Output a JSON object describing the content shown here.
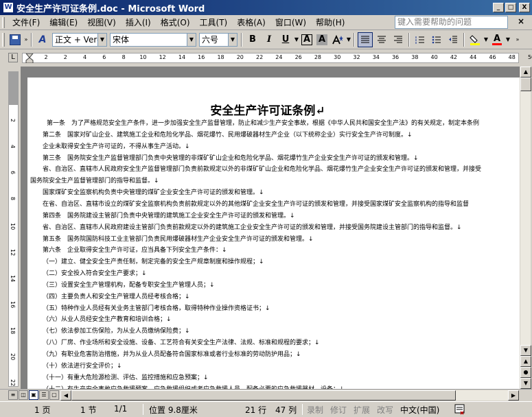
{
  "window": {
    "title": "安全生产许可证条例.doc - Microsoft Word",
    "icon_text": "W",
    "minimize_label": "_",
    "maximize_label": "□",
    "close_label": "X"
  },
  "menu": {
    "items": [
      "文件(F)",
      "编辑(E)",
      "视图(V)",
      "插入(I)",
      "格式(O)",
      "工具(T)",
      "表格(A)",
      "窗口(W)",
      "帮助(H)"
    ],
    "help_placeholder": "键入需要帮助的问题",
    "close_label": "×"
  },
  "toolbar": {
    "style_value": "正文 + Verd",
    "font_value": "宋体",
    "size_value": "六号",
    "bold": "B",
    "italic": "I",
    "underline": "U",
    "char_border": "A",
    "char_shading": "A",
    "font_color": "A",
    "dropdown_arrow": "▼",
    "chevron": "»"
  },
  "ruler": {
    "numbers": [
      "2",
      "2",
      "4",
      "6",
      "8",
      "10",
      "12",
      "14",
      "16",
      "18",
      "20",
      "22",
      "24",
      "26",
      "28",
      "30",
      "32",
      "34",
      "36",
      "38",
      "40",
      "42",
      "44",
      "46",
      "48",
      "50"
    ],
    "corner_label": "L"
  },
  "vruler": {
    "numbers": [
      "2",
      "4",
      "6",
      "8",
      "10",
      "12",
      "14",
      "16",
      "18",
      "20",
      "22"
    ]
  },
  "document": {
    "title": "安全生产许可证条例↵",
    "lines": [
      "第一条　为了严格规范安全生产条件，进一步加强安全生产监督管理，防止和减少生产安全事故，根据《中华人民共和国安全生产法》的有关规定，制定本条例",
      "第二条　国家对矿山企业、建筑施工企业和危险化学品、烟花爆竹、民用爆破器材生产企业（以下统称企业）实行安全生产许可制度。↓",
      "企业未取得安全生产许可证的，不得从事生产活动。↓",
      "第三条　国务院安全生产监督管理部门负责中央管理的非煤矿矿山企业和危险化学品、烟花爆竹生产企业安全生产许可证的颁发和管理。↓",
      "省、自治区、直辖市人民政府安全生产监督管理部门负责前款规定以外的非煤矿矿山企业和危险化学品、烟花爆竹生产企业安全生产许可证的颁发和管理，并接受",
      "国务院安全生产监督管理部门的指导和监督。↓",
      "国家煤矿安全监察机构负责中央管理的煤矿企业安全生产许可证的颁发和管理。↓",
      "在省、自治区、直辖市设立的煤矿安全监察机构负责前款规定以外的其他煤矿企业安全生产许可证的颁发和管理，并接受国家煤矿安全监察机构的指导和监督",
      "第四条　国务院建设主管部门负责中央管理的建筑施工企业安全生产许可证的颁发和管理。↓",
      "省、自治区、直辖市人民政府建设主管部门负责前款规定以外的建筑施工企业安全生产许可证的颁发和管理，并接受国务院建设主管部门的指导和监督。↓",
      "第五条　国务院国防科技工业主管部门负责民用爆破器材生产企业安全生产许可证的颁发和管理。↓",
      "第六条　企业取得安全生产许可证，应当具备下列安全生产条件：↓",
      "（一）建立、健全安全生产责任制，制定完备的安全生产规章制度和操作规程；↓",
      "（二）安全投入符合安全生产要求；↓",
      "（三）设置安全生产管理机构，配备专职安全生产管理人员；↓",
      "（四）主要负责人和安全生产管理人员经考核合格；↓",
      "（五）特种作业人员经有关业务主管部门考核合格，取得特种作业操作资格证书；↓",
      "（六）从业人员经安全生产教育和培训合格；↓",
      "（七）依法参加工伤保险，为从业人员缴纳保险费；↓",
      "（八）厂房、作业场所和安全设施、设备、工艺符合有关安全生产法律、法规、标准和规程的要求；↓",
      "（九）有职业危害防治措施，并为从业人员配备符合国家标准或者行业标准的劳动防护用品；↓",
      "（十）依法进行安全评价；↓",
      "（十一）有重大危险源检测、评估、监控措施和应急预案；↓",
      "（十二）有生产安全事故应急救援预案、应急救援组织或者应急救援人员，配备必要的应急救援器材、设备；↓"
    ]
  },
  "statusbar": {
    "page": "1 页",
    "section": "1 节",
    "page_of": "1/1",
    "position": "位置 9.8厘米",
    "line": "21 行",
    "column": "47 列",
    "rec": "录制",
    "trk": "修订",
    "ext": "扩展",
    "ovr": "改写",
    "language": "中文(中国)"
  }
}
